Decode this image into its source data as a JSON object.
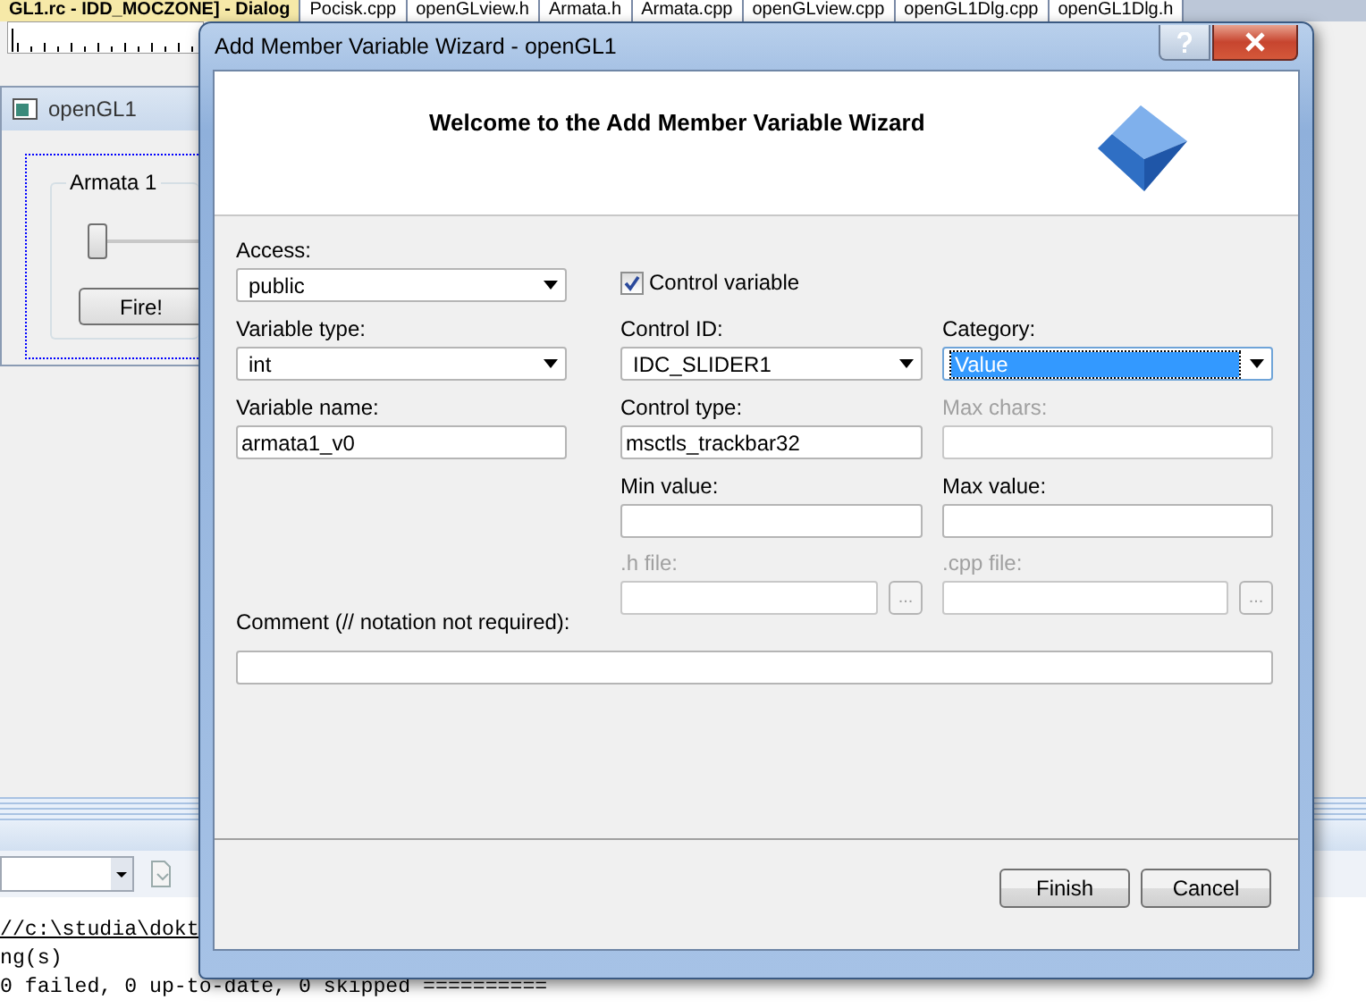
{
  "ide": {
    "tabs": [
      {
        "label": "GL1.rc - IDD_MOCZONE] - Dialog",
        "selected": true
      },
      {
        "label": "Pocisk.cpp",
        "selected": false
      },
      {
        "label": "openGLview.h",
        "selected": false
      },
      {
        "label": "Armata.h",
        "selected": false
      },
      {
        "label": "Armata.cpp",
        "selected": false
      },
      {
        "label": "openGLview.cpp",
        "selected": false
      },
      {
        "label": "openGL1Dlg.cpp",
        "selected": false
      },
      {
        "label": "openGL1Dlg.h",
        "selected": false
      }
    ],
    "preview": {
      "title": "openGL1",
      "group": "Armata 1",
      "slider": {
        "level": 0
      },
      "button": "Fire!"
    },
    "output_lines": [
      {
        "text": "//c:\\studia\\dokt",
        "kind": "link"
      },
      {
        "text": "ng(s)",
        "kind": "text"
      },
      {
        "text": "0 failed, 0 up-to-date, 0 skipped ==========",
        "kind": "text"
      }
    ]
  },
  "wizard": {
    "title": "Add Member Variable Wizard - openGL1",
    "header": "Welcome to the Add Member Variable Wizard",
    "fields": [
      {
        "label": "Access:",
        "kind": "dropdown",
        "value": "public",
        "focused": false
      },
      {
        "label": "Control variable",
        "kind": "checkbox",
        "checked": true
      },
      {
        "label": "Variable type:",
        "kind": "dropdown",
        "value": "int",
        "focused": false
      },
      {
        "label": "Control ID:",
        "kind": "dropdown",
        "value": "IDC_SLIDER1",
        "focused": false
      },
      {
        "label": "Category:",
        "kind": "dropdown",
        "value": "Value",
        "focused": true
      },
      {
        "label": "Variable name:",
        "kind": "text",
        "value": "armata1_v0",
        "disabled": false
      },
      {
        "label": "Control type:",
        "kind": "text",
        "value": "msctls_trackbar32",
        "disabled": false
      },
      {
        "label": "Max chars:",
        "kind": "text",
        "disabled": true
      },
      {
        "label": "Min value:",
        "kind": "text",
        "disabled": false
      },
      {
        "label": "Max value:",
        "kind": "text",
        "disabled": false
      },
      {
        "label": ".h file:",
        "kind": "browse",
        "button": "...",
        "disabled": true
      },
      {
        "label": ".cpp file:",
        "kind": "browse",
        "button": "...",
        "disabled": true
      },
      {
        "label": "Comment (// notation not required):",
        "kind": "comment",
        "disabled": false
      }
    ],
    "buttons": [
      "Finish",
      "Cancel"
    ]
  }
}
